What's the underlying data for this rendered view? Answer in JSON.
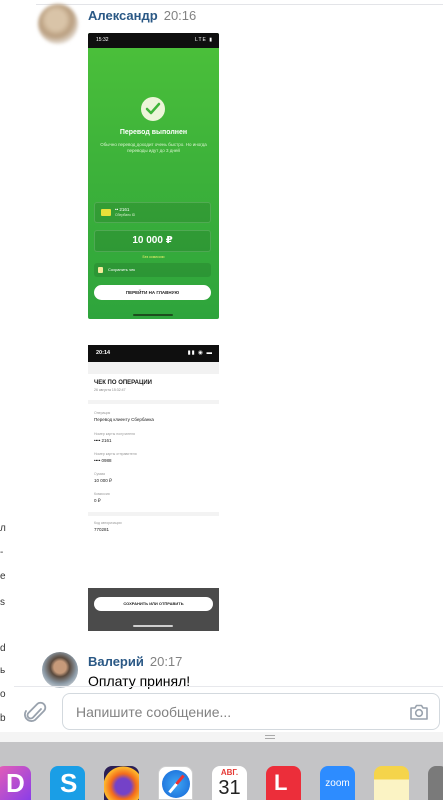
{
  "messages": [
    {
      "sender": "Александр",
      "time": "20:16",
      "attachments": [
        {
          "status_time": "15:32",
          "status_icons": "LTE ▮",
          "title": "Перевод выполнен",
          "subtitle": "Обычно перевод доходит очень быстро. Но иногда переводы идут до 3 дней",
          "card_number": "•• 2161",
          "card_name": "Сбербанк ID",
          "amount": "10 000 ₽",
          "note": "Без комиссии",
          "save_label": "Сохранить чек",
          "button": "ПЕРЕЙТИ НА ГЛАВНУЮ"
        },
        {
          "status_time": "20:14",
          "status_icons": "▮▮ ◉ ▬",
          "title": "ЧЕК ПО ОПЕРАЦИИ",
          "date": "26 августа 15:32:47",
          "fields": [
            {
              "label": "Операция",
              "value": "Перевод клиенту Сбербанка"
            },
            {
              "label": "Номер карты получателя",
              "value": "•••• 2161"
            },
            {
              "label": "Номер карты отправителя",
              "value": "•••• 0988"
            },
            {
              "label": "Сумма",
              "value": "10 000 ₽"
            },
            {
              "label": "Комиссия",
              "value": "0 ₽"
            },
            {
              "label": "Код авторизации",
              "value": "770281"
            }
          ],
          "button": "СОХРАНИТЬ ИЛИ ОТПРАВИТЬ"
        }
      ]
    },
    {
      "sender": "Валерий",
      "time": "20:17",
      "text": "Оплату принял!"
    }
  ],
  "left_strip_chars": [
    "л",
    "-",
    "е",
    "s",
    "d",
    "ь",
    "о",
    "b"
  ],
  "composer": {
    "placeholder": "Напишите сообщение...",
    "attach_icon": "paperclip-icon",
    "camera_icon": "camera-icon"
  },
  "dock": {
    "apps": [
      {
        "name": "d-app",
        "glyph": "D"
      },
      {
        "name": "skype",
        "glyph": "S"
      },
      {
        "name": "firefox",
        "glyph": ""
      },
      {
        "name": "safari",
        "glyph": ""
      },
      {
        "name": "calendar",
        "month": "АВГ.",
        "day": "31"
      },
      {
        "name": "lr-app",
        "glyph": "L"
      },
      {
        "name": "zoom",
        "glyph": "zoom"
      },
      {
        "name": "notes",
        "glyph": ""
      }
    ]
  },
  "colors": {
    "sender": "#2a5885",
    "success_green": "#3fb43a",
    "time": "#828282"
  }
}
